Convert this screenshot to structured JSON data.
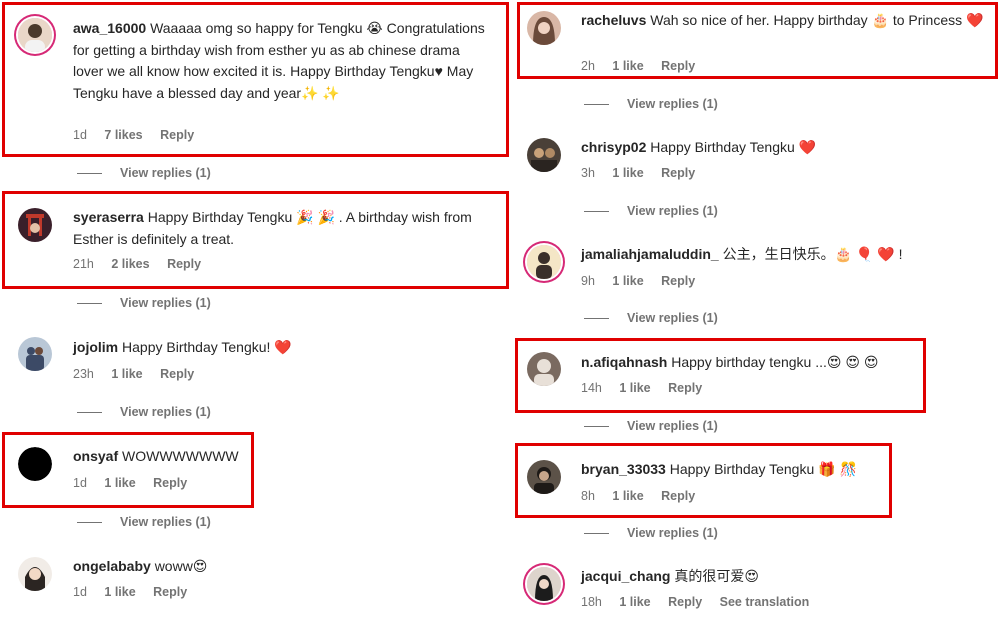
{
  "left_column": [
    {
      "username": "awa_16000",
      "text": "Waaaaa omg so happy for Tengku 😭 Congratulations for getting a birthday wish from esther yu as ab chinese drama lover we all know how excited it is. Happy Birthday Tengku♥ May Tengku have a blessed day and year✨ ✨",
      "time": "1d",
      "likes": "7 likes",
      "reply": "Reply",
      "view_replies": "View replies (1)",
      "avatar": {
        "bg": "#e9d7c8",
        "accent": "#4a3a2c"
      }
    },
    {
      "username": "syeraserra",
      "text": "Happy Birthday Tengku 🎉 🎉 . A birthday wish from Esther is definitely a treat.",
      "time": "21h",
      "likes": "2 likes",
      "reply": "Reply",
      "view_replies": "View replies (1)",
      "avatar": {
        "bg": "#3a1f2a",
        "accent": "#c0392b"
      }
    },
    {
      "username": "jojolim",
      "text": "Happy Birthday Tengku! ❤️",
      "time": "23h",
      "likes": "1 like",
      "reply": "Reply",
      "view_replies": "View replies (1)",
      "avatar": {
        "bg": "#b9c7d6",
        "accent": "#3c4a66"
      }
    },
    {
      "username": "onsyaf",
      "text": "WOWWWWWWW",
      "time": "1d",
      "likes": "1 like",
      "reply": "Reply",
      "view_replies": "View replies (1)",
      "avatar": {
        "bg": "#000000",
        "accent": "#000000"
      }
    },
    {
      "username": "ongelababy",
      "text": "woww😍",
      "time": "1d",
      "likes": "1 like",
      "reply": "Reply",
      "avatar": {
        "bg": "#f1ece7",
        "accent": "#2b2522"
      }
    }
  ],
  "right_column": [
    {
      "username": "racheluvs",
      "text": "Wah so nice of her. Happy birthday 🎂 to Princess ❤️",
      "time": "2h",
      "likes": "1 like",
      "reply": "Reply",
      "view_replies": "View replies (1)",
      "avatar": {
        "bg": "#d9b7a6",
        "accent": "#6b4a3a"
      }
    },
    {
      "username": "chrisyp02",
      "text": "Happy Birthday Tengku ❤️",
      "time": "3h",
      "likes": "1 like",
      "reply": "Reply",
      "view_replies": "View replies (1)",
      "avatar": {
        "bg": "#4a4038",
        "accent": "#c9a27a"
      }
    },
    {
      "username": "jamaliahjamaluddin_",
      "text": "公主，生日快乐。🎂 🎈 ❤️ !",
      "time": "9h",
      "likes": "1 like",
      "reply": "Reply",
      "view_replies": "View replies (1)",
      "avatar": {
        "bg": "#f4e6c6",
        "accent": "#3a2f2a"
      }
    },
    {
      "username": "n.afiqahnash",
      "text": "Happy birthday tengku ...😍 😍 😍",
      "time": "14h",
      "likes": "1 like",
      "reply": "Reply",
      "view_replies": "View replies (1)",
      "avatar": {
        "bg": "#7a6a60",
        "accent": "#e8e0d8"
      }
    },
    {
      "username": "bryan_33033",
      "text": "Happy Birthday Tengku 🎁 🎊",
      "time": "8h",
      "likes": "1 like",
      "reply": "Reply",
      "view_replies": "View replies (1)",
      "avatar": {
        "bg": "#5c5248",
        "accent": "#1e1a17"
      }
    },
    {
      "username": "jacqui_chang",
      "text": "真的很可爱😍",
      "time": "18h",
      "likes": "1 like",
      "reply": "Reply",
      "translate": "See translation",
      "avatar": {
        "bg": "#ddd4cc",
        "accent": "#1c1c1c"
      }
    }
  ],
  "colors": {
    "highlight": "#e00000",
    "heart": "#ed1c24",
    "muted": "#737373",
    "text": "#262626"
  }
}
